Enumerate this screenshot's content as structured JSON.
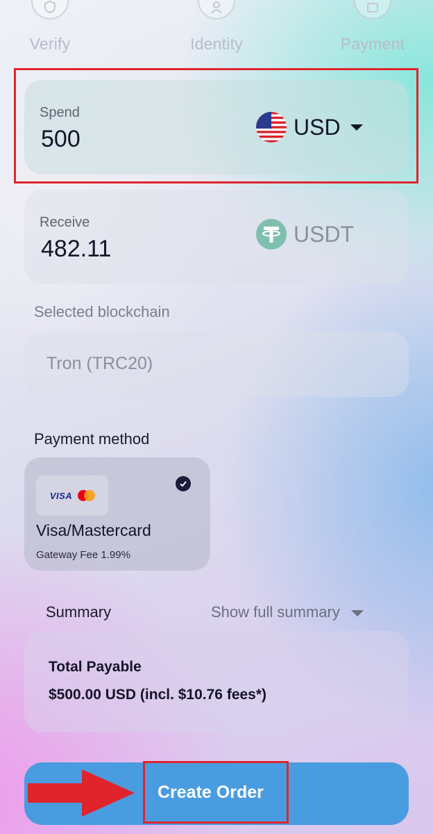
{
  "steps": [
    {
      "label": "Verify",
      "icon": "shield-icon"
    },
    {
      "label": "Identity",
      "icon": "user-icon"
    },
    {
      "label": "Payment",
      "icon": "wallet-icon"
    }
  ],
  "spend": {
    "label": "Spend",
    "value": "500",
    "currency": "USD",
    "flag_icon": "us-flag-icon"
  },
  "receive": {
    "label": "Receive",
    "value": "482.11",
    "currency": "USDT",
    "token_icon": "tether-icon"
  },
  "blockchain": {
    "label": "Selected blockchain",
    "value": "Tron (TRC20)"
  },
  "payment_method": {
    "label": "Payment method",
    "option": {
      "name": "Visa/Mastercard",
      "fee": "Gateway Fee 1.99%",
      "logo_text": "VISA",
      "selected": true
    }
  },
  "summary": {
    "title": "Summary",
    "toggle_label": "Show full summary",
    "total_label": "Total Payable",
    "total_value": "$500.00 USD (incl. $10.76 fees*)"
  },
  "create_order": {
    "label": "Create Order"
  },
  "colors": {
    "accent": "#4a9ce0",
    "highlight": "#e0242c",
    "text_dark": "#141428"
  }
}
